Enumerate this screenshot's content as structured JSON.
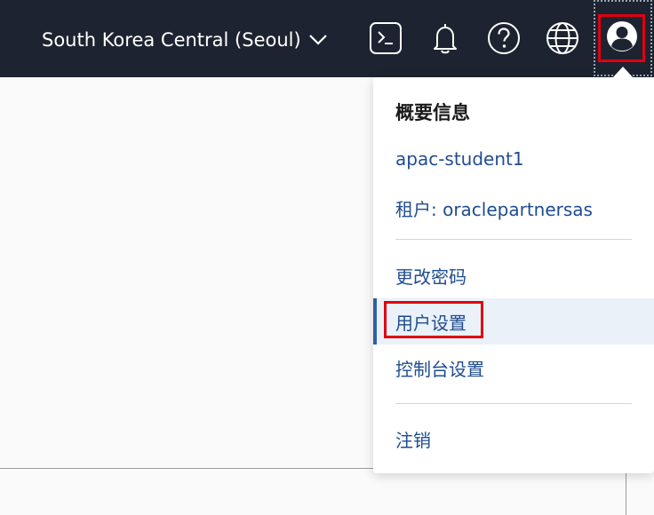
{
  "topbar": {
    "region_label": "South Korea Central (Seoul)",
    "icons": [
      "cloud-shell-icon",
      "notifications-bell-icon",
      "help-icon",
      "language-globe-icon",
      "user-profile-icon"
    ]
  },
  "menu": {
    "section_title": "概要信息",
    "username": "apac-student1",
    "tenancy": "租户: oraclepartnersas",
    "items": [
      {
        "label": "更改密码",
        "active": false
      },
      {
        "label": "用户设置",
        "active": true
      },
      {
        "label": "控制台设置",
        "active": false
      }
    ],
    "sign_out": "注销"
  },
  "colors": {
    "topbar_bg": "#1d2330",
    "link": "#1f4c8f",
    "active_bg": "#eaf1f9",
    "active_bar": "#2d5ea8",
    "highlight": "#e0000f"
  }
}
